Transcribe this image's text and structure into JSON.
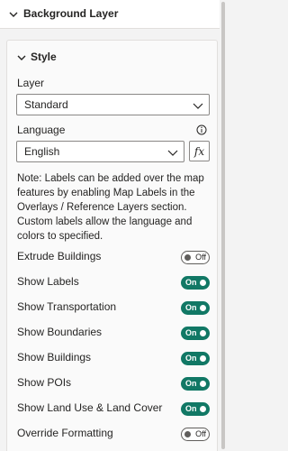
{
  "section": {
    "title": "Background Layer"
  },
  "style_group": {
    "title": "Style"
  },
  "layer": {
    "label": "Layer",
    "value": "Standard"
  },
  "language": {
    "label": "Language",
    "value": "English",
    "fx_label": "fx"
  },
  "note": "Note: Labels can be added over the map features by enabling Map Labels in the Overlays / Reference Layers section. Custom labels allow the language and colors to specified.",
  "toggles": [
    {
      "label": "Extrude Buildings",
      "state": "Off",
      "on": false
    },
    {
      "label": "Show Labels",
      "state": "On",
      "on": true
    },
    {
      "label": "Show Transportation",
      "state": "On",
      "on": true
    },
    {
      "label": "Show Boundaries",
      "state": "On",
      "on": true
    },
    {
      "label": "Show Buildings",
      "state": "On",
      "on": true
    },
    {
      "label": "Show POIs",
      "state": "On",
      "on": true
    },
    {
      "label": "Show Land Use & Land Cover",
      "state": "On",
      "on": true
    },
    {
      "label": "Override Formatting",
      "state": "Off",
      "on": false
    }
  ],
  "colors": {
    "toggle_on": "#117865",
    "toggle_off_border": "#605e5c"
  }
}
